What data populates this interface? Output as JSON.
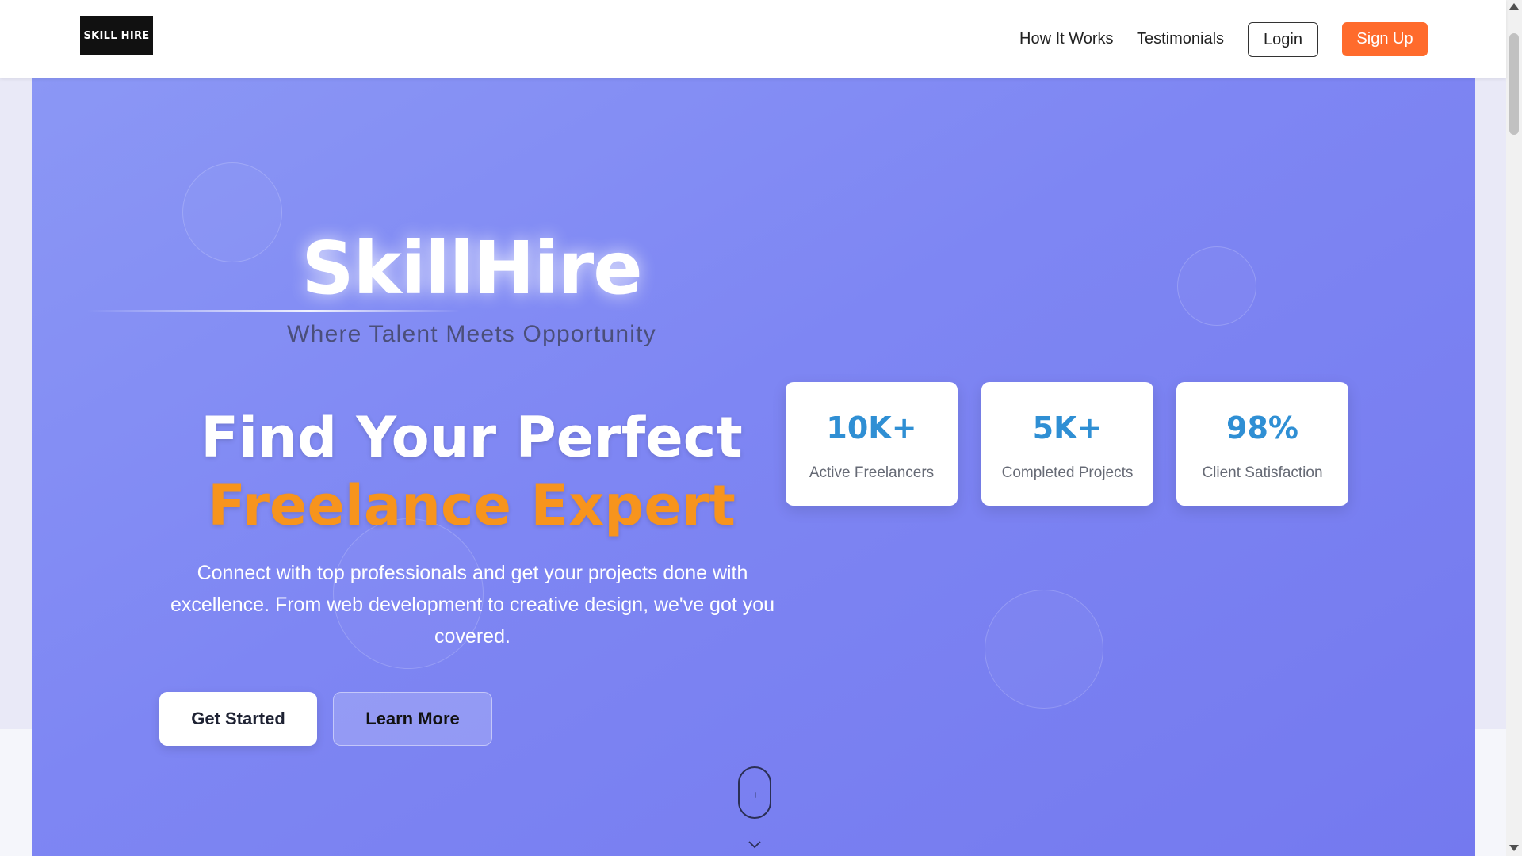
{
  "header": {
    "logo_text": "SKILL HIRE",
    "nav": [
      {
        "label": "How It Works"
      },
      {
        "label": "Testimonials"
      }
    ],
    "login_label": "Login",
    "signup_label": "Sign Up"
  },
  "hero": {
    "brand_title": "SkillHire",
    "tagline": "Where Talent Meets Opportunity",
    "headline_line1": "Find Your Perfect",
    "headline_line2": "Freelance Expert",
    "description": "Connect with top professionals and get your projects done with excellence. From web development to creative design, we've got you covered.",
    "primary_cta": "Get Started",
    "secondary_cta": "Learn More",
    "scroll_icon": "mouse-scroll-icon"
  },
  "stats": [
    {
      "value": "10K+",
      "label": "Active Freelancers"
    },
    {
      "value": "5K+",
      "label": "Completed Projects"
    },
    {
      "value": "98%",
      "label": "Client Satisfaction"
    }
  ],
  "colors": {
    "accent_orange": "#f7941d",
    "signup_orange": "#ff6b2c",
    "stat_blue": "#2f8fd4",
    "hero_gradient_start": "#8b97f5",
    "hero_gradient_end": "#7479ef"
  }
}
